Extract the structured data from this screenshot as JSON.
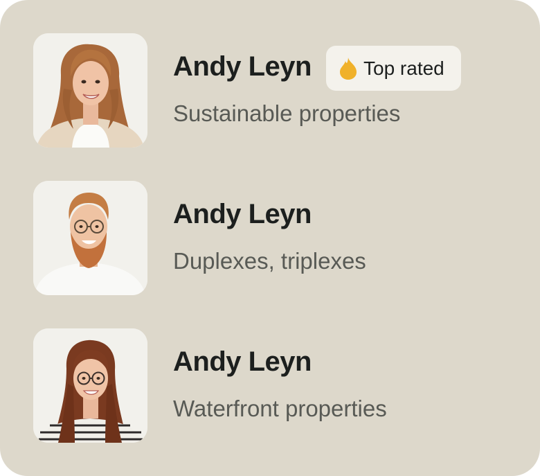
{
  "agents": [
    {
      "name": "Andy Leyn",
      "specialty": "Sustainable properties",
      "badge": {
        "label": "Top rated",
        "icon": "flame-icon",
        "color": "#f0b12a"
      },
      "avatar": "woman-curly-hair-portrait"
    },
    {
      "name": "Andy Leyn",
      "specialty": "Duplexes, triplexes",
      "avatar": "man-beard-glasses-portrait"
    },
    {
      "name": "Andy Leyn",
      "specialty": "Waterfront properties",
      "avatar": "woman-glasses-portrait"
    }
  ],
  "colors": {
    "card_background": "#ddd8cb",
    "avatar_background": "#f2f1ec",
    "name_text": "#1c1f1e",
    "specialty_text": "#585a55",
    "badge_background": "#f4f2ec"
  }
}
